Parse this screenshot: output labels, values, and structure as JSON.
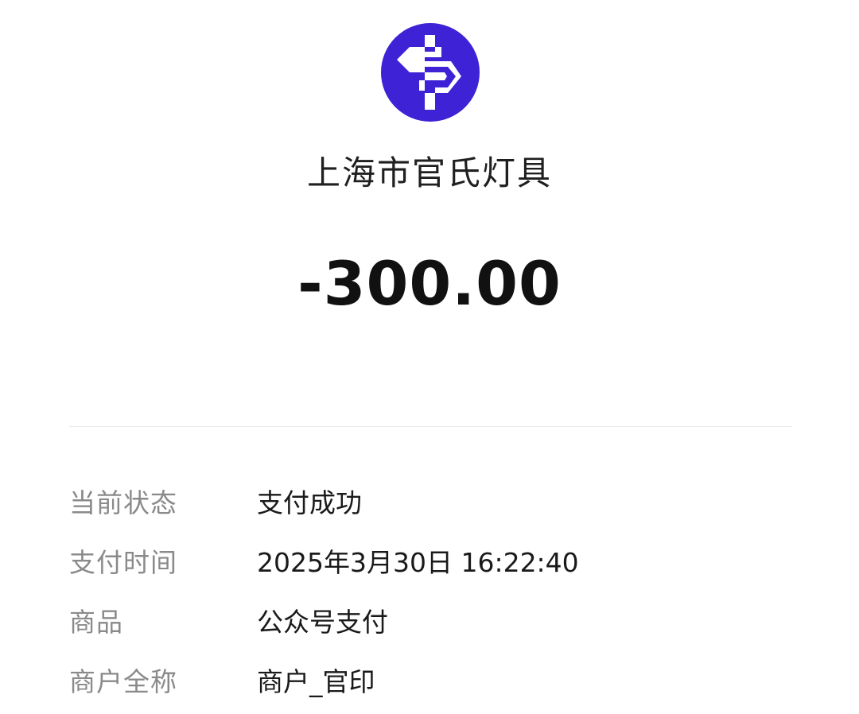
{
  "merchant": {
    "logo_icon": "merchant-logo-icon",
    "logo_color": "#3D22D6",
    "name": "上海市官氏灯具"
  },
  "transaction": {
    "amount": "-300.00"
  },
  "details": [
    {
      "label": "当前状态",
      "value": "支付成功"
    },
    {
      "label": "支付时间",
      "value": "2025年3月30日 16:22:40"
    },
    {
      "label": "商品",
      "value": "公众号支付"
    },
    {
      "label": "商户全称",
      "value": "商户_官印"
    }
  ]
}
